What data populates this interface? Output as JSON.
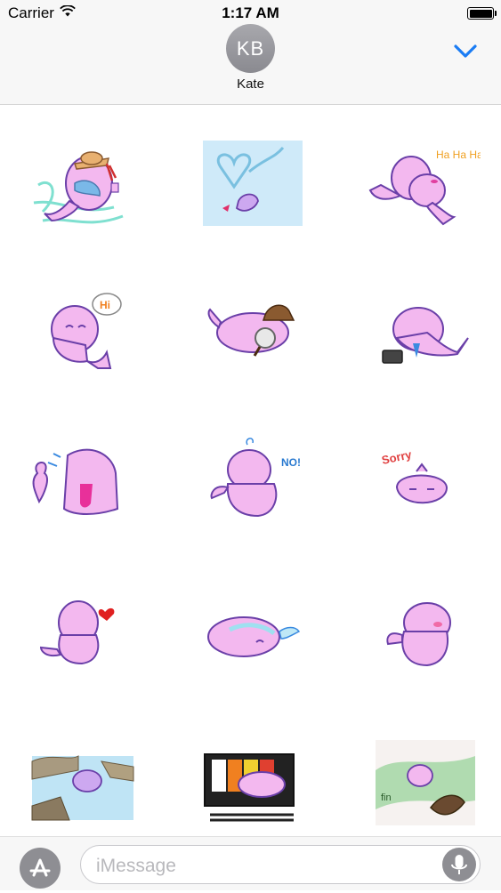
{
  "status_bar": {
    "carrier": "Carrier",
    "time": "1:17 AM",
    "wifi_icon": "wifi-icon",
    "battery_icon": "battery-icon"
  },
  "header": {
    "avatar_initials": "KB",
    "contact_name": "Kate",
    "collapse_icon": "chevron-down-icon",
    "accent_color": "#1a7cf4"
  },
  "stickers": {
    "s1": {
      "text": ""
    },
    "s3": {
      "text": "Ha Ha Ha"
    },
    "s4": {
      "text": "Hi"
    },
    "s8": {
      "text": "NO!"
    },
    "s9": {
      "text": "Sorry"
    },
    "s15": {
      "text": "fin"
    }
  },
  "compose": {
    "placeholder": "iMessage",
    "app_store_icon": "app-store-icon",
    "mic_icon": "microphone-icon"
  },
  "colors": {
    "sticker_pink": "#f3b8ef",
    "outline": "#6a3fa8"
  }
}
